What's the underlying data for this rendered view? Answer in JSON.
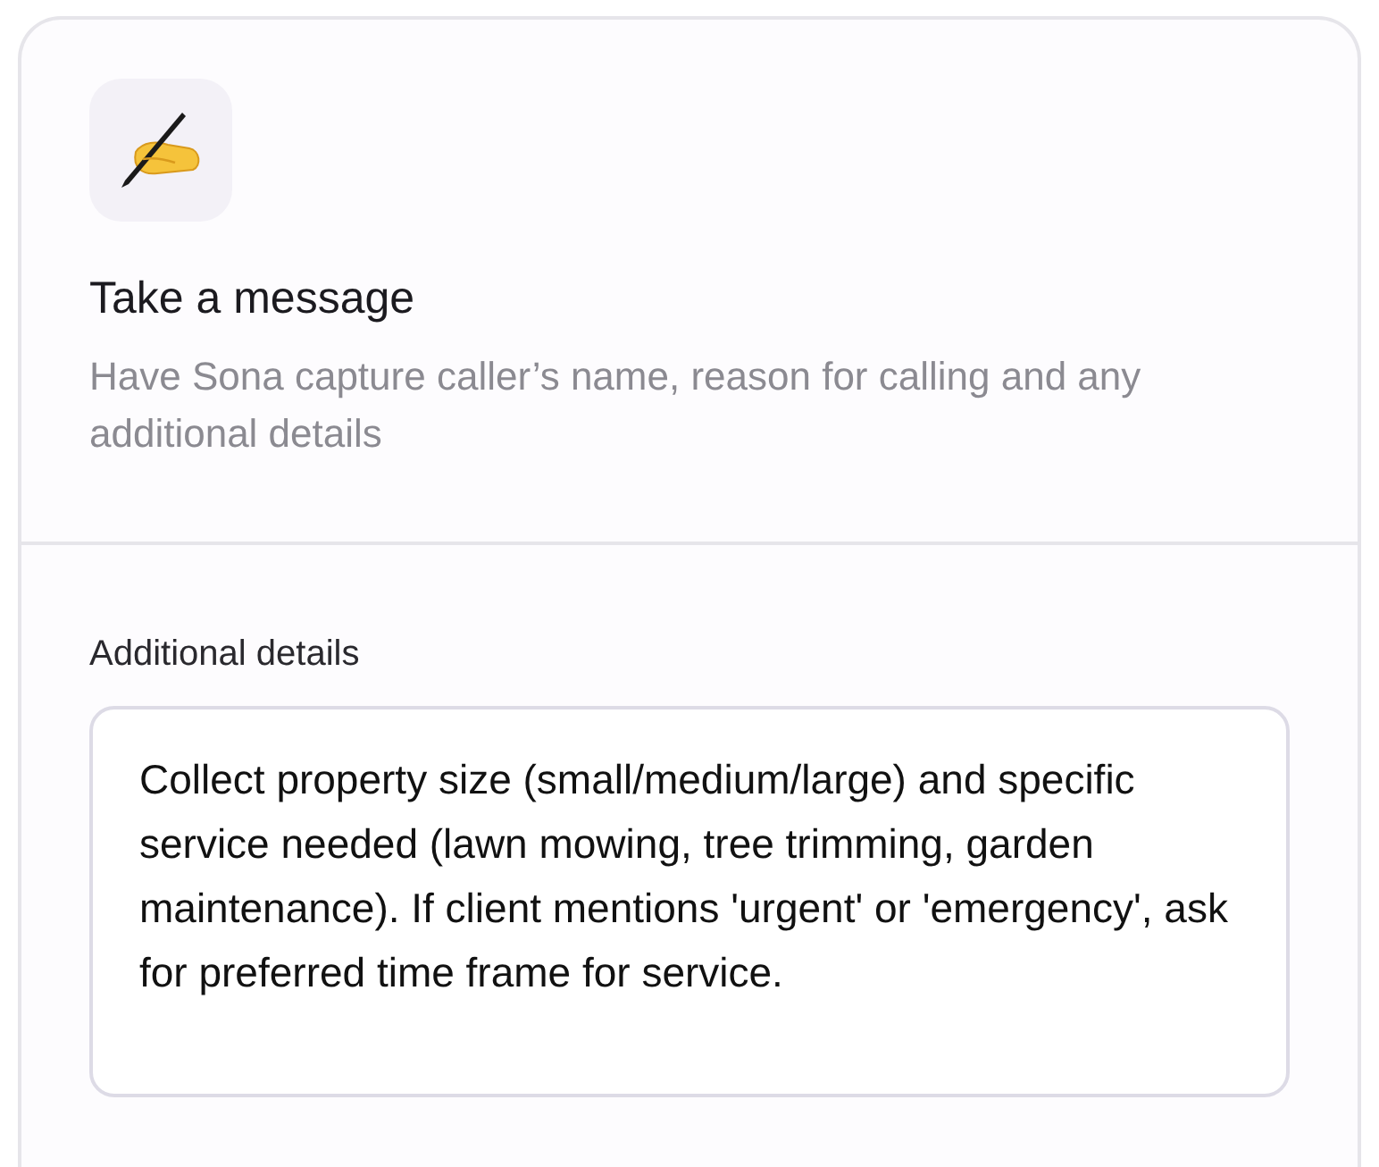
{
  "card": {
    "icon": {
      "kind": "writing-hand"
    },
    "title": "Take a message",
    "description": "Have Sona capture caller’s name, reason for calling and any additional details"
  },
  "details": {
    "label": "Additional details",
    "value": "Collect property size (small/medium/large) and specific service needed (lawn mowing, tree trimming, garden maintenance). If client mentions 'urgent' or 'emergency', ask for preferred time frame for service."
  }
}
